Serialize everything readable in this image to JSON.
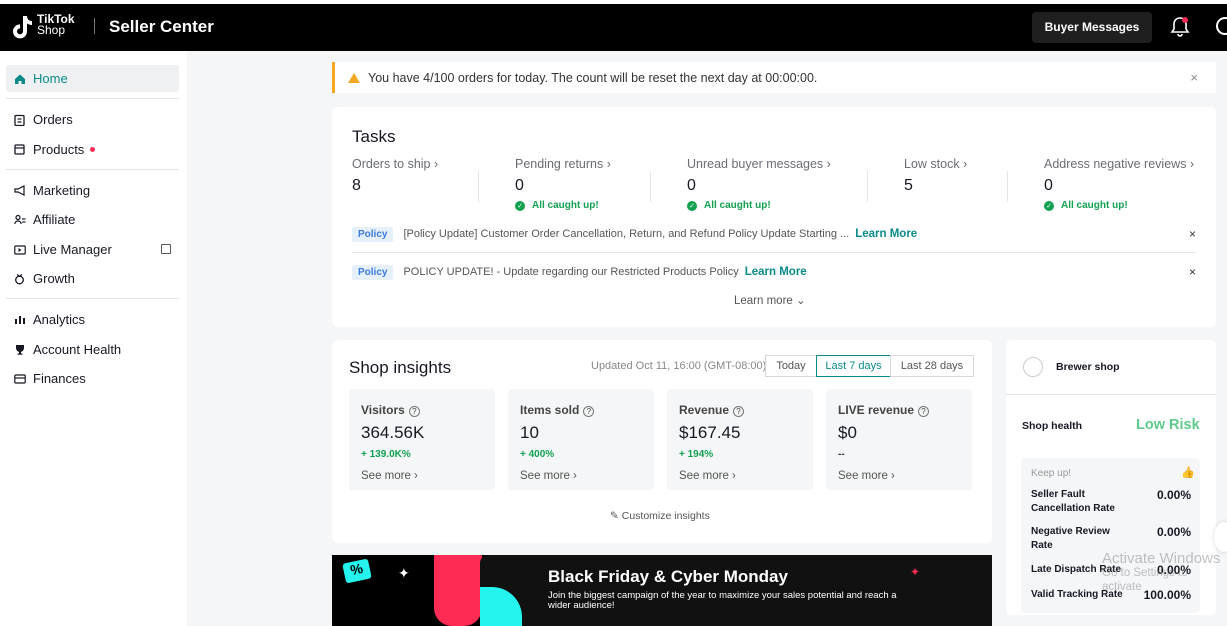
{
  "header": {
    "logo_line1": "TikTok",
    "logo_line2": "Shop",
    "title": "Seller Center",
    "buyer_messages": "Buyer Messages"
  },
  "sidebar": {
    "items": [
      {
        "label": "Home",
        "icon": "home-icon"
      },
      {
        "label": "Orders",
        "icon": "clipboard-icon"
      },
      {
        "label": "Products",
        "icon": "box-icon"
      },
      {
        "label": "Marketing",
        "icon": "megaphone-icon"
      },
      {
        "label": "Affiliate",
        "icon": "people-icon"
      },
      {
        "label": "Live Manager",
        "icon": "live-icon"
      },
      {
        "label": "Growth",
        "icon": "growth-icon"
      },
      {
        "label": "Analytics",
        "icon": "chart-icon"
      },
      {
        "label": "Account Health",
        "icon": "trophy-icon"
      },
      {
        "label": "Finances",
        "icon": "wallet-icon"
      }
    ]
  },
  "alert": {
    "text": "You have 4/100 orders for today. The count will be reset the next day at 00:00:00.",
    "close": "×"
  },
  "tasks": {
    "title": "Tasks",
    "items": [
      {
        "label": "Orders to ship ›",
        "value": "8",
        "status": ""
      },
      {
        "label": "Pending returns ›",
        "value": "0",
        "status": "All caught up!"
      },
      {
        "label": "Unread buyer messages ›",
        "value": "0",
        "status": "All caught up!"
      },
      {
        "label": "Low stock ›",
        "value": "5",
        "status": ""
      },
      {
        "label": "Address negative reviews ›",
        "value": "0",
        "status": "All caught up!"
      }
    ],
    "policies": [
      {
        "badge": "Policy",
        "text": "[Policy Update] Customer Order Cancellation, Return, and Refund Policy Update Starting ...",
        "link": "Learn More",
        "close": "×"
      },
      {
        "badge": "Policy",
        "text": "POLICY UPDATE! - Update regarding our Restricted Products Policy",
        "link": "Learn More",
        "close": "×"
      }
    ],
    "learn_more": "Learn more ⌄"
  },
  "insights": {
    "title": "Shop insights",
    "updated": "Updated Oct 11, 16:00 (GMT-08:00)",
    "ranges": [
      "Today",
      "Last 7 days",
      "Last 28 days"
    ],
    "selected_range": "Last 7 days",
    "metrics": [
      {
        "label": "Visitors",
        "value": "364.56K",
        "change": "+ 139.0K%",
        "see_more": "See more ›"
      },
      {
        "label": "Items sold",
        "value": "10",
        "change": "+ 400%",
        "see_more": "See more ›"
      },
      {
        "label": "Revenue",
        "value": "$167.45",
        "change": "+ 194%",
        "see_more": "See more ›"
      },
      {
        "label": "LIVE revenue",
        "value": "$0",
        "change": "--",
        "see_more": "See more ›"
      }
    ],
    "customize": "Customize insights"
  },
  "shop": {
    "name": "Brewer shop",
    "health_label": "Shop health",
    "health_value": "Low Risk",
    "keep_up": "Keep up!",
    "rates": [
      {
        "label": "Seller Fault Cancellation Rate",
        "value": "0.00%"
      },
      {
        "label": "Negative Review Rate",
        "value": "0.00%"
      },
      {
        "label": "Late Dispatch Rate",
        "value": "0.00%"
      },
      {
        "label": "Valid Tracking Rate",
        "value": "100.00%"
      }
    ]
  },
  "banner": {
    "title": "Black Friday & Cyber Monday",
    "subtitle": "Join the biggest campaign of the year to maximize your sales potential and reach a wider audience!",
    "tag": "%"
  },
  "watermark": {
    "line1": "Activate Windows",
    "line2": "Go to Settings to activate"
  },
  "colors": {
    "accent": "#0b8a8a",
    "success": "#12a150",
    "warning": "#f5a623",
    "brand_pink": "#fe2c55",
    "brand_cyan": "#25f4ee"
  }
}
